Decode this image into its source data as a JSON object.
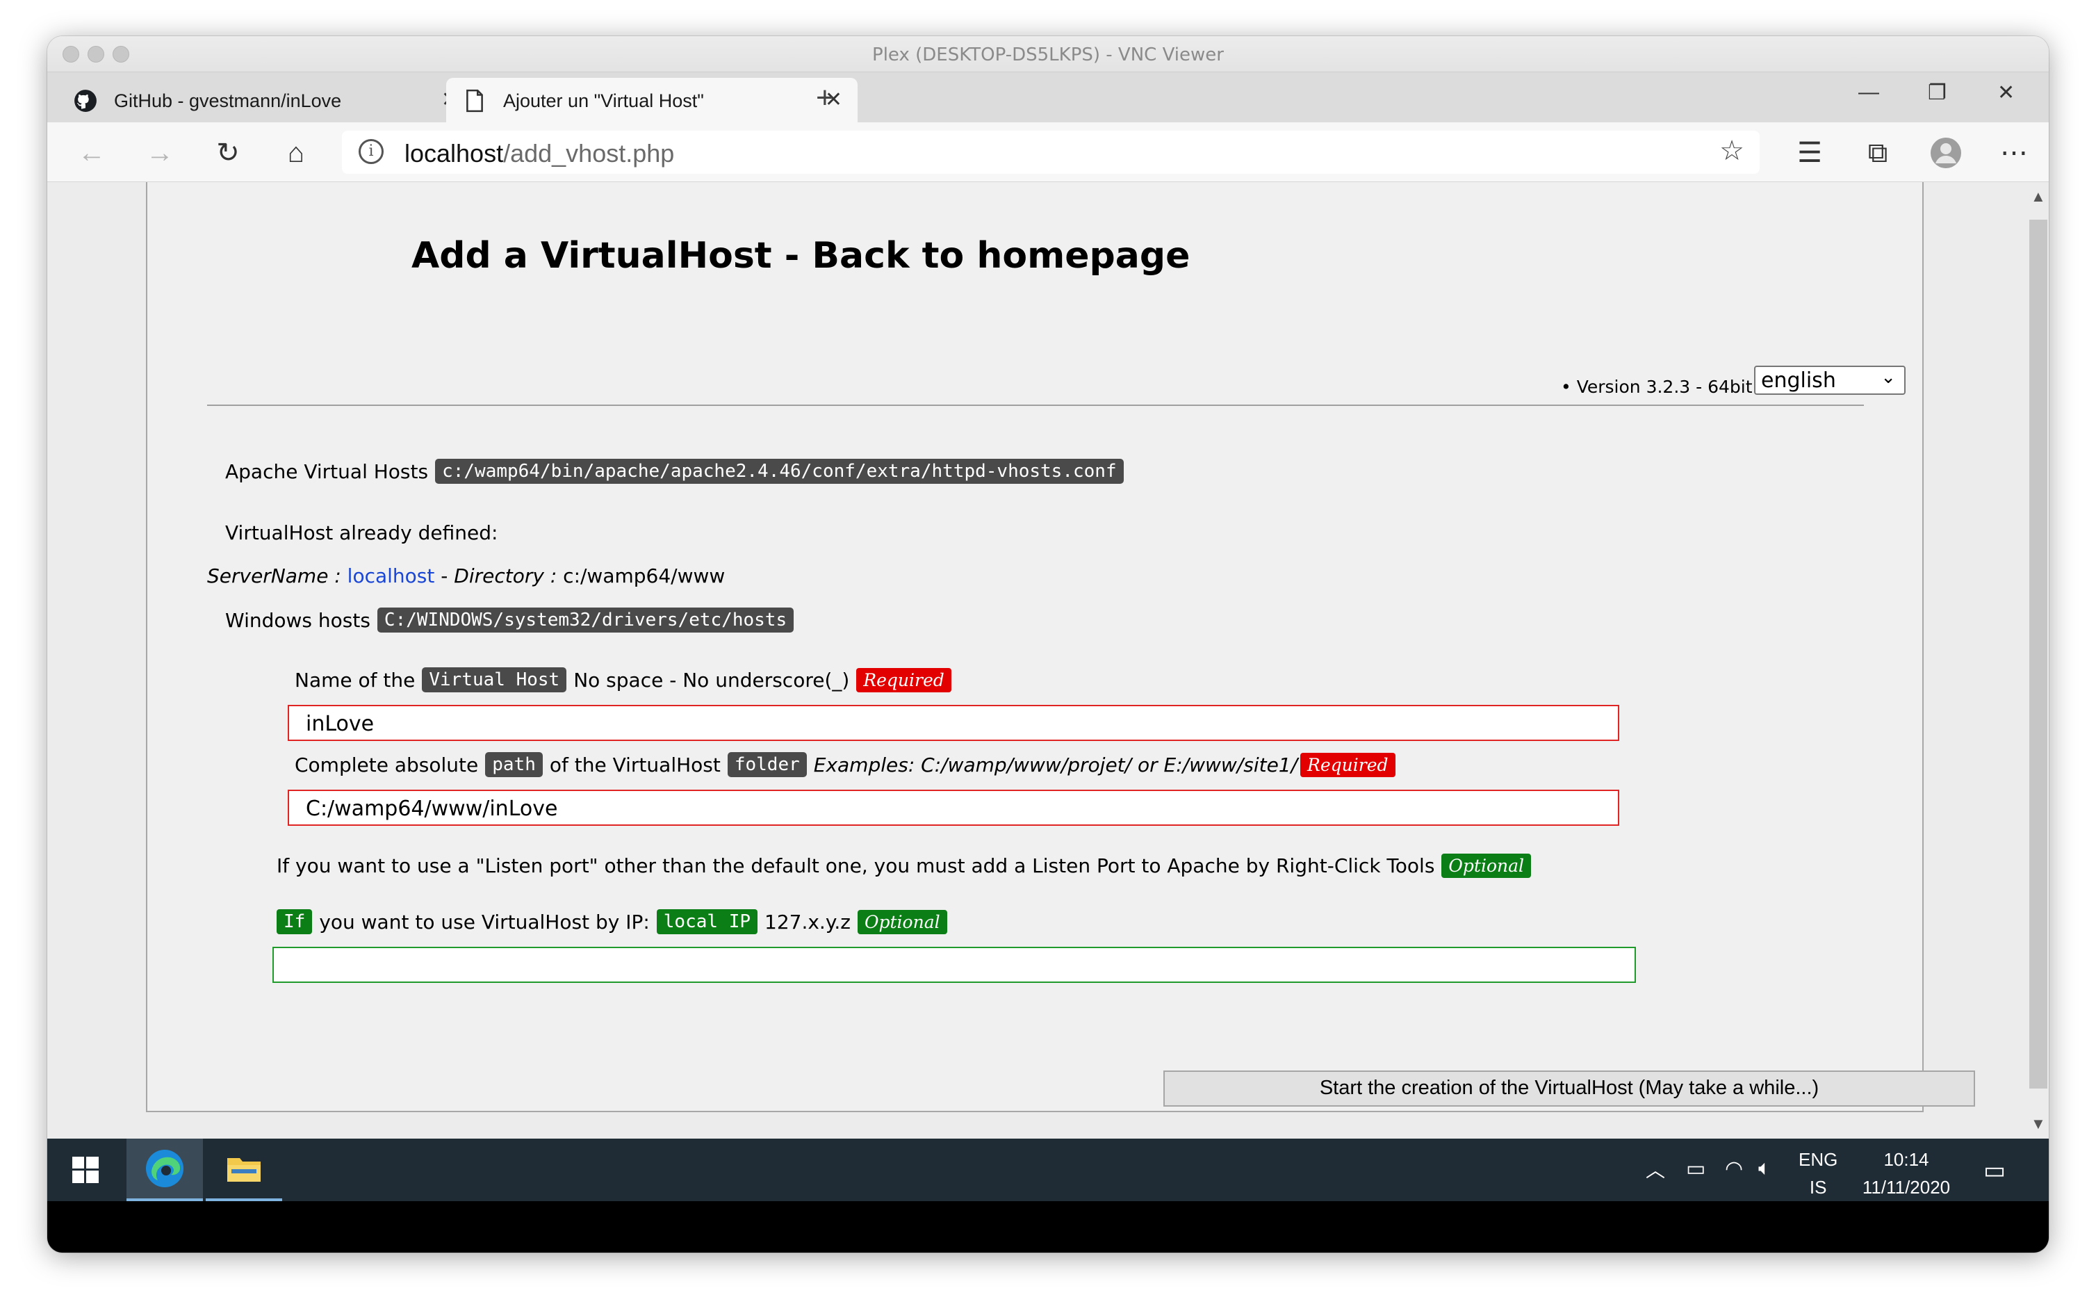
{
  "mac_window": {
    "title": "Plex (DESKTOP-DS5LKPS) - VNC Viewer"
  },
  "browser": {
    "tabs": [
      {
        "label": "GitHub - gvestmann/inLove",
        "icon": "github-icon",
        "active": false
      },
      {
        "label": "Ajouter un \"Virtual Host\"",
        "icon": "document-icon",
        "active": true
      }
    ],
    "url_host": "localhost",
    "url_path": "/add_vhost.php"
  },
  "page": {
    "title": "Add a VirtualHost - Back to homepage",
    "version": "Version 3.2.3 - 64bit",
    "language_selected": "english",
    "apache_label": "Apache Virtual Hosts",
    "apache_path": "c:/wamp64/bin/apache/apache2.4.46/conf/extra/httpd-vhosts.conf",
    "defined_label": "VirtualHost already defined:",
    "servername_label": "ServerName :",
    "servername_value": "localhost",
    "directory_sep": " - ",
    "directory_label": "Directory :",
    "directory_value": "c:/wamp64/www",
    "hosts_label": "Windows hosts",
    "hosts_path": "C:/WINDOWS/system32/drivers/etc/hosts",
    "name_label_pre": "Name of the",
    "name_code": "Virtual Host",
    "name_note": "No space - No underscore(_)",
    "required_badge": "Required",
    "name_value": "inLove",
    "path_label_pre": "Complete absolute",
    "path_code": "path",
    "path_label_mid": "of the VirtualHost",
    "path_code2": "folder",
    "path_examples": "Examples: C:/wamp/www/projet/ or E:/www/site1/",
    "path_value": "C:/wamp64/www/inLove",
    "listen_text": "If you want to use a \"Listen port\" other than the default one, you must add a Listen Port to Apache by Right-Click Tools",
    "optional_badge": "Optional",
    "ip_if": "If",
    "ip_text": "you want to use VirtualHost by IP:",
    "ip_code": "local IP",
    "ip_range": "127.x.y.z",
    "ip_value": "",
    "submit_label": "Start the creation of the VirtualHost (May take a while...)"
  },
  "taskbar": {
    "lang_line1": "ENG",
    "lang_line2": "IS",
    "time": "10:14",
    "date": "11/11/2020"
  },
  "colors": {
    "required": "#e20000",
    "optional": "#0b7f16",
    "code_bg": "#4a4a4a",
    "link": "#1a46d6",
    "taskbar": "#1f2b35"
  }
}
